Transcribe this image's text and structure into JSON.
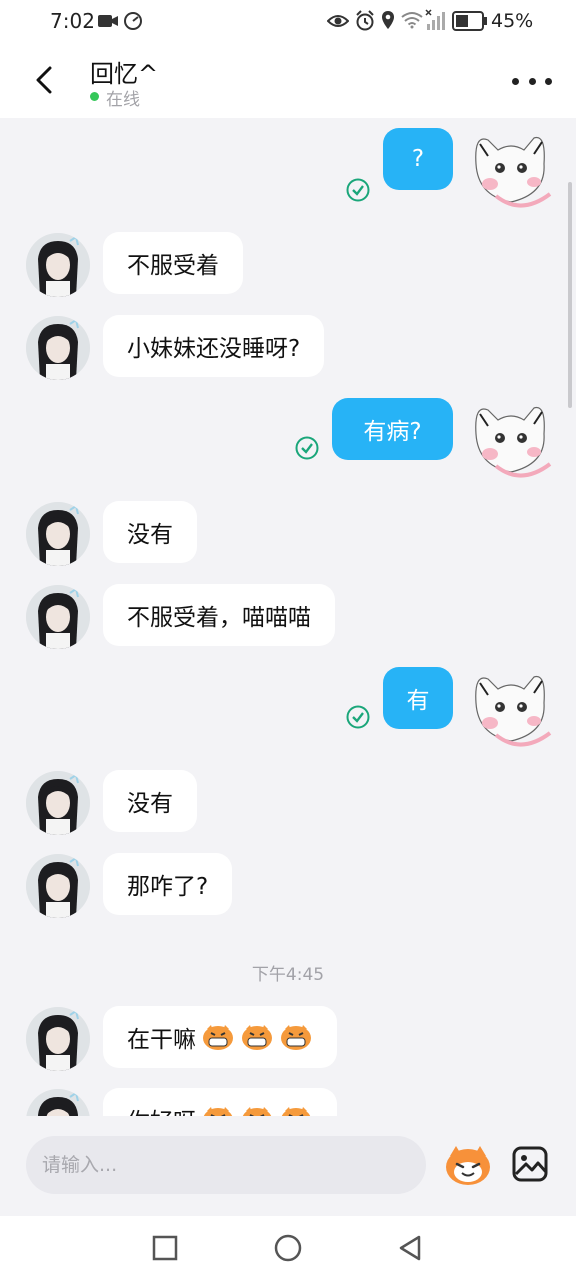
{
  "status_bar": {
    "time": "7:02",
    "battery_percent": "45%",
    "left_icons": [
      "video-camera-icon",
      "speedometer-icon"
    ],
    "right_icons": [
      "eye-icon",
      "alarm-icon",
      "location-icon",
      "wifi-icon",
      "signal-icon",
      "battery-icon"
    ]
  },
  "header": {
    "contact_name": "回忆^",
    "status": "在线",
    "status_color": "#35c759"
  },
  "messages": [
    {
      "side": "right",
      "text": "?",
      "read": true
    },
    {
      "side": "left",
      "text": "不服受着"
    },
    {
      "side": "left",
      "text": "小妹妹还没睡呀?"
    },
    {
      "side": "right",
      "text": "有病?",
      "read": true
    },
    {
      "side": "left",
      "text": "没有"
    },
    {
      "side": "left",
      "text": "不服受着，喵喵喵"
    },
    {
      "side": "right",
      "text": "有",
      "read": true
    },
    {
      "side": "left",
      "text": "没有"
    },
    {
      "side": "left",
      "text": "那咋了?"
    },
    {
      "timestamp": "下午4:45"
    },
    {
      "side": "left",
      "text": "在干嘛",
      "emoji": [
        "tiger-face",
        "tiger-face",
        "tiger-face"
      ]
    },
    {
      "side": "left",
      "text": "你好呀",
      "emoji": [
        "tiger-face",
        "tiger-face",
        "tiger-face"
      ],
      "partially_visible": true
    }
  ],
  "input": {
    "placeholder": "请输入..."
  },
  "colors": {
    "accent_blue": "#27b3f6",
    "read_check": "#1aa67a",
    "background": "#f3f3f6"
  }
}
